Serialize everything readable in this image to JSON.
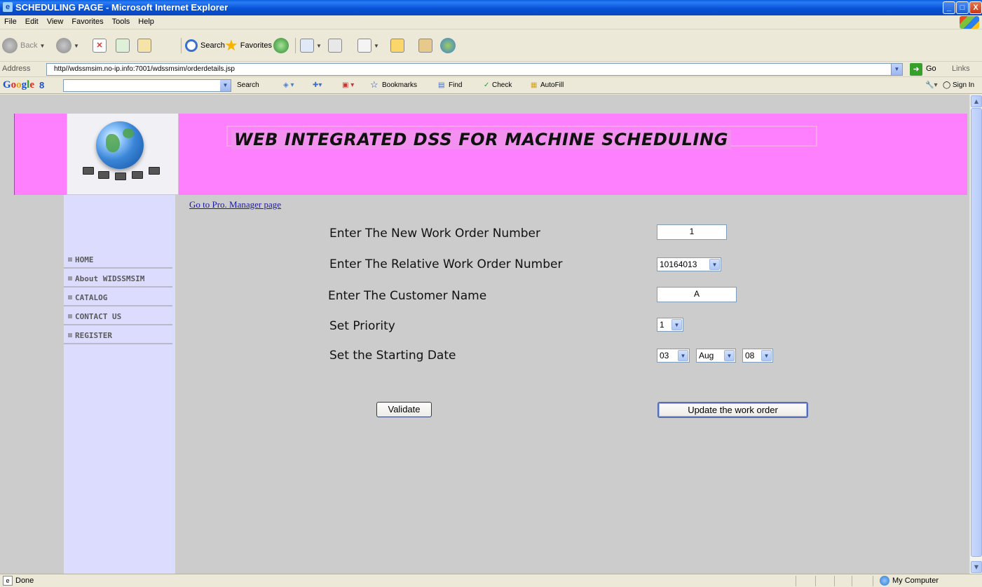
{
  "window": {
    "title": "SCHEDULING PAGE - Microsoft Internet Explorer",
    "minimize": "_",
    "maximize": "□",
    "close": "X"
  },
  "menu": [
    "File",
    "Edit",
    "View",
    "Favorites",
    "Tools",
    "Help"
  ],
  "toolbar": {
    "back": "Back",
    "search": "Search",
    "favorites": "Favorites"
  },
  "address": {
    "label": "Address",
    "url": "http//wdssmsim.no-ip.info:7001/wdssmsim/orderdetails.jsp",
    "go": "Go",
    "links": "Links"
  },
  "google_bar": {
    "logo": [
      "G",
      "o",
      "o",
      "g",
      "l",
      "e"
    ],
    "badge": "8",
    "search": "Search",
    "bookmarks": "Bookmarks",
    "find": "Find",
    "check": "Check",
    "autofill": "AutoFill",
    "sign_in": "Sign In"
  },
  "page": {
    "banner_title": "WEB INTEGRATED DSS FOR MACHINE SCHEDULING",
    "pro_manager_link": "Go to Pro. Manager page",
    "nav": [
      "HOME",
      "About WIDSSMSIM",
      "CATALOG",
      "CONTACT US",
      "REGISTER"
    ],
    "form": {
      "work_order_label": "Enter The New Work Order Number",
      "work_order_value": "1",
      "relative_order_label": "Enter The Relative Work Order Number",
      "relative_order_value": "10164013",
      "customer_label": "Enter The Customer Name",
      "customer_value": "A",
      "priority_label": "Set Priority",
      "priority_value": "1",
      "start_date_label": "Set the Starting Date",
      "start_day": "03",
      "start_month": "Aug",
      "start_year": "08"
    },
    "validate_button": "Validate",
    "update_button": "Update the work order"
  },
  "status": {
    "text": "Done",
    "zone": "My Computer"
  }
}
